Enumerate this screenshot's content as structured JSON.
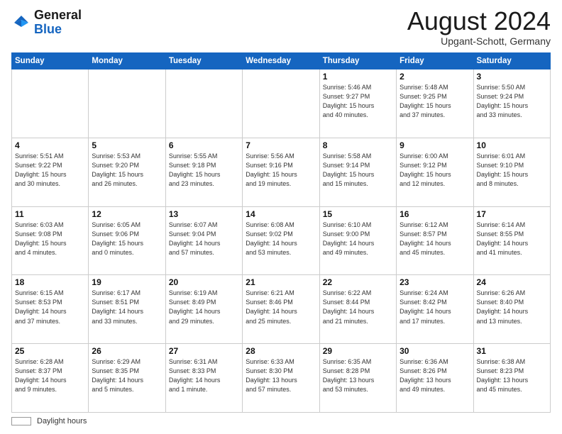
{
  "header": {
    "logo_line1": "General",
    "logo_line2": "Blue",
    "month_title": "August 2024",
    "location": "Upgant-Schott, Germany"
  },
  "footer": {
    "legend_label": "Daylight hours"
  },
  "days_of_week": [
    "Sunday",
    "Monday",
    "Tuesday",
    "Wednesday",
    "Thursday",
    "Friday",
    "Saturday"
  ],
  "weeks": [
    [
      {
        "day": "",
        "info": ""
      },
      {
        "day": "",
        "info": ""
      },
      {
        "day": "",
        "info": ""
      },
      {
        "day": "",
        "info": ""
      },
      {
        "day": "1",
        "info": "Sunrise: 5:46 AM\nSunset: 9:27 PM\nDaylight: 15 hours\nand 40 minutes."
      },
      {
        "day": "2",
        "info": "Sunrise: 5:48 AM\nSunset: 9:25 PM\nDaylight: 15 hours\nand 37 minutes."
      },
      {
        "day": "3",
        "info": "Sunrise: 5:50 AM\nSunset: 9:24 PM\nDaylight: 15 hours\nand 33 minutes."
      }
    ],
    [
      {
        "day": "4",
        "info": "Sunrise: 5:51 AM\nSunset: 9:22 PM\nDaylight: 15 hours\nand 30 minutes."
      },
      {
        "day": "5",
        "info": "Sunrise: 5:53 AM\nSunset: 9:20 PM\nDaylight: 15 hours\nand 26 minutes."
      },
      {
        "day": "6",
        "info": "Sunrise: 5:55 AM\nSunset: 9:18 PM\nDaylight: 15 hours\nand 23 minutes."
      },
      {
        "day": "7",
        "info": "Sunrise: 5:56 AM\nSunset: 9:16 PM\nDaylight: 15 hours\nand 19 minutes."
      },
      {
        "day": "8",
        "info": "Sunrise: 5:58 AM\nSunset: 9:14 PM\nDaylight: 15 hours\nand 15 minutes."
      },
      {
        "day": "9",
        "info": "Sunrise: 6:00 AM\nSunset: 9:12 PM\nDaylight: 15 hours\nand 12 minutes."
      },
      {
        "day": "10",
        "info": "Sunrise: 6:01 AM\nSunset: 9:10 PM\nDaylight: 15 hours\nand 8 minutes."
      }
    ],
    [
      {
        "day": "11",
        "info": "Sunrise: 6:03 AM\nSunset: 9:08 PM\nDaylight: 15 hours\nand 4 minutes."
      },
      {
        "day": "12",
        "info": "Sunrise: 6:05 AM\nSunset: 9:06 PM\nDaylight: 15 hours\nand 0 minutes."
      },
      {
        "day": "13",
        "info": "Sunrise: 6:07 AM\nSunset: 9:04 PM\nDaylight: 14 hours\nand 57 minutes."
      },
      {
        "day": "14",
        "info": "Sunrise: 6:08 AM\nSunset: 9:02 PM\nDaylight: 14 hours\nand 53 minutes."
      },
      {
        "day": "15",
        "info": "Sunrise: 6:10 AM\nSunset: 9:00 PM\nDaylight: 14 hours\nand 49 minutes."
      },
      {
        "day": "16",
        "info": "Sunrise: 6:12 AM\nSunset: 8:57 PM\nDaylight: 14 hours\nand 45 minutes."
      },
      {
        "day": "17",
        "info": "Sunrise: 6:14 AM\nSunset: 8:55 PM\nDaylight: 14 hours\nand 41 minutes."
      }
    ],
    [
      {
        "day": "18",
        "info": "Sunrise: 6:15 AM\nSunset: 8:53 PM\nDaylight: 14 hours\nand 37 minutes."
      },
      {
        "day": "19",
        "info": "Sunrise: 6:17 AM\nSunset: 8:51 PM\nDaylight: 14 hours\nand 33 minutes."
      },
      {
        "day": "20",
        "info": "Sunrise: 6:19 AM\nSunset: 8:49 PM\nDaylight: 14 hours\nand 29 minutes."
      },
      {
        "day": "21",
        "info": "Sunrise: 6:21 AM\nSunset: 8:46 PM\nDaylight: 14 hours\nand 25 minutes."
      },
      {
        "day": "22",
        "info": "Sunrise: 6:22 AM\nSunset: 8:44 PM\nDaylight: 14 hours\nand 21 minutes."
      },
      {
        "day": "23",
        "info": "Sunrise: 6:24 AM\nSunset: 8:42 PM\nDaylight: 14 hours\nand 17 minutes."
      },
      {
        "day": "24",
        "info": "Sunrise: 6:26 AM\nSunset: 8:40 PM\nDaylight: 14 hours\nand 13 minutes."
      }
    ],
    [
      {
        "day": "25",
        "info": "Sunrise: 6:28 AM\nSunset: 8:37 PM\nDaylight: 14 hours\nand 9 minutes."
      },
      {
        "day": "26",
        "info": "Sunrise: 6:29 AM\nSunset: 8:35 PM\nDaylight: 14 hours\nand 5 minutes."
      },
      {
        "day": "27",
        "info": "Sunrise: 6:31 AM\nSunset: 8:33 PM\nDaylight: 14 hours\nand 1 minute."
      },
      {
        "day": "28",
        "info": "Sunrise: 6:33 AM\nSunset: 8:30 PM\nDaylight: 13 hours\nand 57 minutes."
      },
      {
        "day": "29",
        "info": "Sunrise: 6:35 AM\nSunset: 8:28 PM\nDaylight: 13 hours\nand 53 minutes."
      },
      {
        "day": "30",
        "info": "Sunrise: 6:36 AM\nSunset: 8:26 PM\nDaylight: 13 hours\nand 49 minutes."
      },
      {
        "day": "31",
        "info": "Sunrise: 6:38 AM\nSunset: 8:23 PM\nDaylight: 13 hours\nand 45 minutes."
      }
    ]
  ]
}
